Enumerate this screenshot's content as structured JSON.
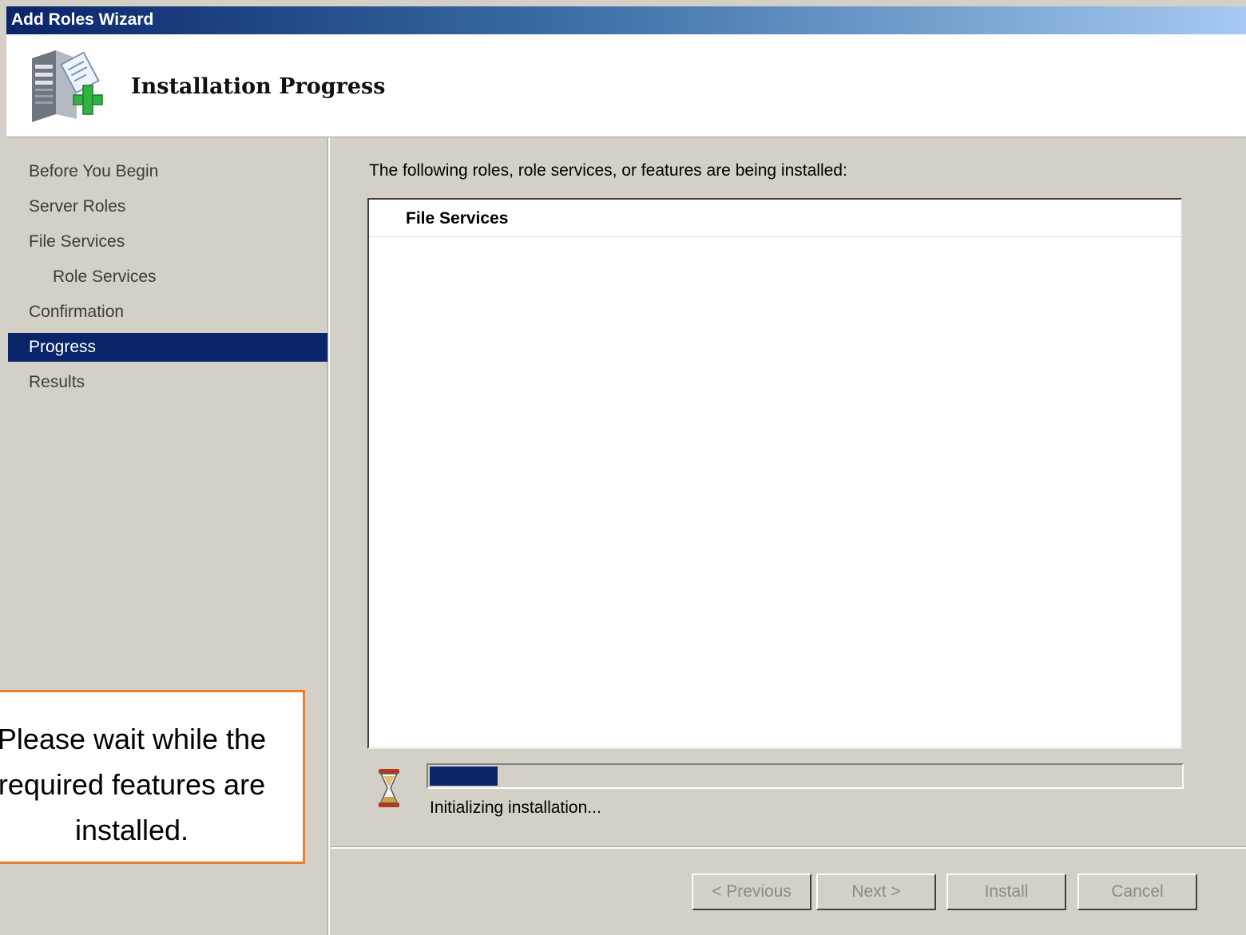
{
  "window": {
    "title": "Add Roles Wizard"
  },
  "header": {
    "title": "Installation Progress",
    "icon": "server-add-icon"
  },
  "sidebar": {
    "items": [
      {
        "label": "Before You Begin",
        "indent": false,
        "active": false
      },
      {
        "label": "Server Roles",
        "indent": false,
        "active": false
      },
      {
        "label": "File Services",
        "indent": false,
        "active": false
      },
      {
        "label": "Role Services",
        "indent": true,
        "active": false
      },
      {
        "label": "Confirmation",
        "indent": false,
        "active": false
      },
      {
        "label": "Progress",
        "indent": false,
        "active": true
      },
      {
        "label": "Results",
        "indent": false,
        "active": false
      }
    ]
  },
  "content": {
    "intro": "The following roles, role services, or features are being installed:",
    "list_heading": "File Services",
    "progress_fraction": 0.09,
    "status": "Initializing installation...",
    "status_icon": "hourglass-icon"
  },
  "buttons": {
    "previous": "< Previous",
    "next": "Next >",
    "install": "Install",
    "cancel": "Cancel"
  },
  "callout": {
    "lines": [
      "Please wait while the",
      "required features are",
      "installed."
    ]
  },
  "colors": {
    "selection": "#0a246a",
    "callout_border": "#ed7d31",
    "window_bg": "#d4d0c8"
  }
}
